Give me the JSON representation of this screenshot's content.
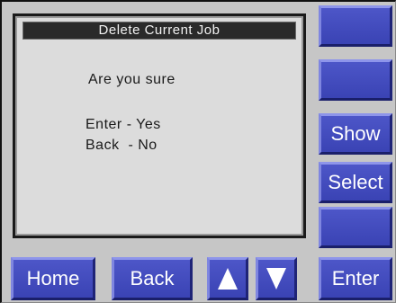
{
  "screen": {
    "title": "Delete Current Job",
    "question": "Are you sure",
    "option_yes": "Enter - Yes",
    "option_no": "Back  - No"
  },
  "side_buttons": {
    "show": "Show",
    "select": "Select",
    "enter": "Enter"
  },
  "bottom_buttons": {
    "home": "Home",
    "back": "Back",
    "up_icon": "arrow-up",
    "down_icon": "arrow-down"
  },
  "colors": {
    "button_blue": "#4148bd",
    "panel_gray": "#c6c6c6",
    "screen_bg": "#dcdcdc",
    "title_bar": "#2a2a2a"
  }
}
